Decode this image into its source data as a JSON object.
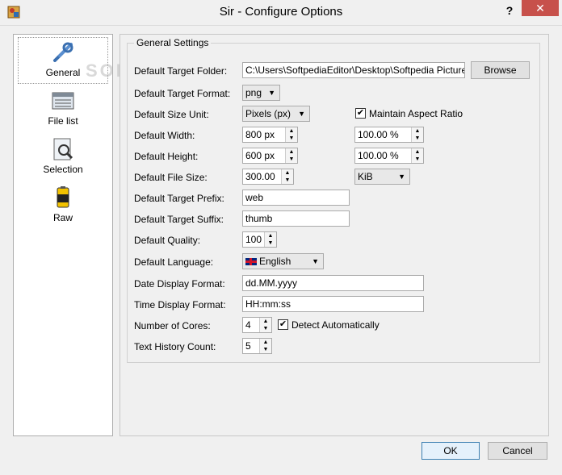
{
  "window": {
    "title": "Sir - Configure Options",
    "help": "?",
    "close": "✕"
  },
  "sidebar": {
    "items": [
      {
        "label": "General",
        "icon": "tools-icon"
      },
      {
        "label": "File list",
        "icon": "file-list-icon"
      },
      {
        "label": "Selection",
        "icon": "selection-icon"
      },
      {
        "label": "Raw",
        "icon": "raw-icon"
      }
    ]
  },
  "group": {
    "title": "General Settings"
  },
  "fields": {
    "target_folder": {
      "label": "Default Target Folder:",
      "value": "C:\\Users\\SoftpediaEditor\\Desktop\\Softpedia Pictures",
      "browse": "Browse"
    },
    "target_format": {
      "label": "Default Target Format:",
      "value": "png"
    },
    "size_unit": {
      "label": "Default Size Unit:",
      "value": "Pixels (px)",
      "maintain_label": "Maintain Aspect Ratio"
    },
    "width": {
      "label": "Default Width:",
      "value": "800 px",
      "percent": "100.00 %"
    },
    "height": {
      "label": "Default Height:",
      "value": "600 px",
      "percent": "100.00 %"
    },
    "file_size": {
      "label": "Default File Size:",
      "value": "300.00",
      "unit": "KiB"
    },
    "prefix": {
      "label": "Default Target Prefix:",
      "value": "web"
    },
    "suffix": {
      "label": "Default Target Suffix:",
      "value": "thumb"
    },
    "quality": {
      "label": "Default Quality:",
      "value": "100"
    },
    "language": {
      "label": "Default Language:",
      "value": "English"
    },
    "date_format": {
      "label": "Date Display Format:",
      "value": "dd.MM.yyyy"
    },
    "time_format": {
      "label": "Time Display Format:",
      "value": "HH:mm:ss"
    },
    "cores": {
      "label": "Number of Cores:",
      "value": "4",
      "detect_label": "Detect Automatically"
    },
    "history": {
      "label": "Text History Count:",
      "value": "5"
    }
  },
  "footer": {
    "ok": "OK",
    "cancel": "Cancel"
  },
  "watermark": "SOFTPEDIA"
}
